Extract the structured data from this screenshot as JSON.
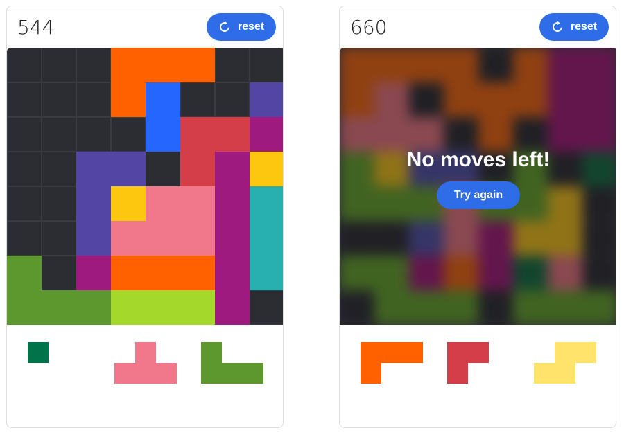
{
  "games": [
    {
      "score": "544",
      "reset_label": "reset",
      "board": [
        [
          "#2c2c33",
          "#2c2c33",
          "#2c2c33",
          "#ff6000",
          "#ff6000",
          "#ff6000",
          "#2c2c33",
          "#2c2c33"
        ],
        [
          "#2c2c33",
          "#2c2c33",
          "#2c2c33",
          "#ff6000",
          "#2466ff",
          "#2c2c33",
          "#2c2c33",
          "#5345a3"
        ],
        [
          "#2c2c33",
          "#2c2c33",
          "#2c2c33",
          "#2c2c33",
          "#2466ff",
          "#d43e48",
          "#d43e48",
          "#9e1a7e"
        ],
        [
          "#2c2c33",
          "#2c2c33",
          "#5345a3",
          "#5345a3",
          "#2c2c33",
          "#d43e48",
          "#9e1a7e",
          "#fdc60f"
        ],
        [
          "#2c2c33",
          "#2c2c33",
          "#5345a3",
          "#fdc60f",
          "#f0788a",
          "#f0788a",
          "#9e1a7e",
          "#28afb0"
        ],
        [
          "#2c2c33",
          "#2c2c33",
          "#5345a3",
          "#f0788a",
          "#f0788a",
          "#f0788a",
          "#9e1a7e",
          "#28afb0"
        ],
        [
          "#5c982e",
          "#2c2c33",
          "#9e1a7e",
          "#ff6000",
          "#ff6000",
          "#ff6000",
          "#9e1a7e",
          "#28afb0"
        ],
        [
          "#5c982e",
          "#5c982e",
          "#5c982e",
          "#a4d82b",
          "#a4d82b",
          "#a4d82b",
          "#9e1a7e",
          "#2c2c33"
        ]
      ],
      "game_over": false,
      "tray": [
        {
          "color": "#00734a",
          "cells": [
            [
              0,
              0
            ]
          ]
        },
        {
          "color": "#f0788a",
          "cells": [
            [
              1,
              0
            ],
            [
              0,
              1
            ],
            [
              1,
              1
            ],
            [
              2,
              1
            ]
          ]
        },
        {
          "color": "#5c982e",
          "cells": [
            [
              0,
              0
            ],
            [
              0,
              1
            ],
            [
              1,
              1
            ],
            [
              2,
              1
            ]
          ]
        }
      ]
    },
    {
      "score": "660",
      "reset_label": "reset",
      "board": [
        [
          "#c85a18",
          "#c85a18",
          "#c85a18",
          "#c85a18",
          "#2c2c33",
          "#c85a18",
          "#8a1e6a",
          "#8a1e6a"
        ],
        [
          "#c85a18",
          "#c06570",
          "#2c2c33",
          "#c85a18",
          "#c85a18",
          "#c85a18",
          "#8a1e6a",
          "#8a1e6a"
        ],
        [
          "#c06570",
          "#c06570",
          "#c06570",
          "#2c2c33",
          "#c85a18",
          "#2c2c33",
          "#8a1e6a",
          "#8a1e6a"
        ],
        [
          "#5a8a2e",
          "#c8a020",
          "#4a4a90",
          "#4a4a90",
          "#2c2c33",
          "#5a8a2e",
          "#2c2c33",
          "#1a6040"
        ],
        [
          "#5a8a2e",
          "#5a8a2e",
          "#5a8a2e",
          "#c06570",
          "#5a8a2e",
          "#5a8a2e",
          "#c8a020",
          "#2c2c33"
        ],
        [
          "#2c2c33",
          "#2c2c33",
          "#4a4a90",
          "#c06570",
          "#8a1e6a",
          "#c8a020",
          "#c8a020",
          "#2c2c33"
        ],
        [
          "#5a8a2e",
          "#5a8a2e",
          "#8a1e6a",
          "#c85a18",
          "#8a1e6a",
          "#1a6040",
          "#c06570",
          "#2c2c33"
        ],
        [
          "#2c2c33",
          "#5a8a2e",
          "#5a8a2e",
          "#5a8a2e",
          "#2c2c33",
          "#5a8a2e",
          "#5a8a2e",
          "#5a8a2e"
        ]
      ],
      "game_over": true,
      "overlay_title": "No moves left!",
      "try_again_label": "Try again",
      "tray": [
        {
          "color": "#ff6000",
          "cells": [
            [
              0,
              0
            ],
            [
              1,
              0
            ],
            [
              2,
              0
            ],
            [
              0,
              1
            ]
          ]
        },
        {
          "color": "#d43e48",
          "cells": [
            [
              0,
              0
            ],
            [
              1,
              0
            ],
            [
              0,
              1
            ]
          ]
        },
        {
          "color": "#ffe36b",
          "cells": [
            [
              1,
              0
            ],
            [
              2,
              0
            ],
            [
              0,
              1
            ],
            [
              1,
              1
            ]
          ]
        }
      ]
    }
  ]
}
